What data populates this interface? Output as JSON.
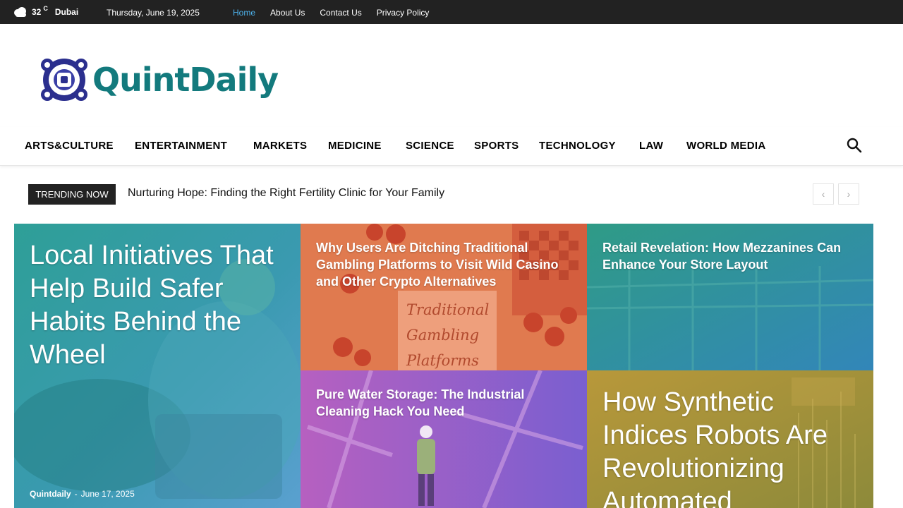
{
  "topbar": {
    "temperature": "32",
    "unit": "C",
    "city": "Dubai",
    "date": "Thursday, June 19, 2025",
    "links": [
      "Home",
      "About Us",
      "Contact Us",
      "Privacy Policy"
    ]
  },
  "logo": {
    "text": "QuintDaily"
  },
  "nav": {
    "items": [
      "ARTS&CULTURE",
      "ENTERTAINMENT",
      "MARKETS",
      "MEDICINE",
      "SCIENCE",
      "SPORTS",
      "TECHNOLOGY",
      "LAW",
      "WORLD MEDIA"
    ],
    "search_icon": "search-icon"
  },
  "trending": {
    "label": "TRENDING NOW",
    "headline": "Nurturing Hope: Finding the Right Fertility Clinic for Your Family",
    "prev": "‹",
    "next": "›"
  },
  "tiles": [
    {
      "title": "Local Initiatives That Help Build Safer Habits Behind the Wheel",
      "author": "Quintdaily",
      "separator": "-",
      "date": "June 17, 2025"
    },
    {
      "title": "Why Users Are Ditching Traditional Gambling Platforms to Visit Wild Casino and Other Crypto Alternatives",
      "image_text": [
        "Traditional",
        "Gambling",
        "Platforms"
      ]
    },
    {
      "title": "Retail Revelation: How Mezzanines Can Enhance Your Store Layout"
    },
    {
      "title": "Pure Water Storage: The Industrial Cleaning Hack You Need"
    },
    {
      "title": "How Synthetic Indices Robots Are Revolutionizing Automated"
    }
  ],
  "colors": {
    "topbar_bg": "#222222",
    "active_link": "#4db2ec",
    "logo_text": "#137a7d",
    "tile1_tint": "#2aa39a",
    "tile2_tint": "#e3764d",
    "tile3_tint": "#2e93a6",
    "tile4_tint": "#9a5cc4",
    "tile5_tint": "#b29638"
  }
}
